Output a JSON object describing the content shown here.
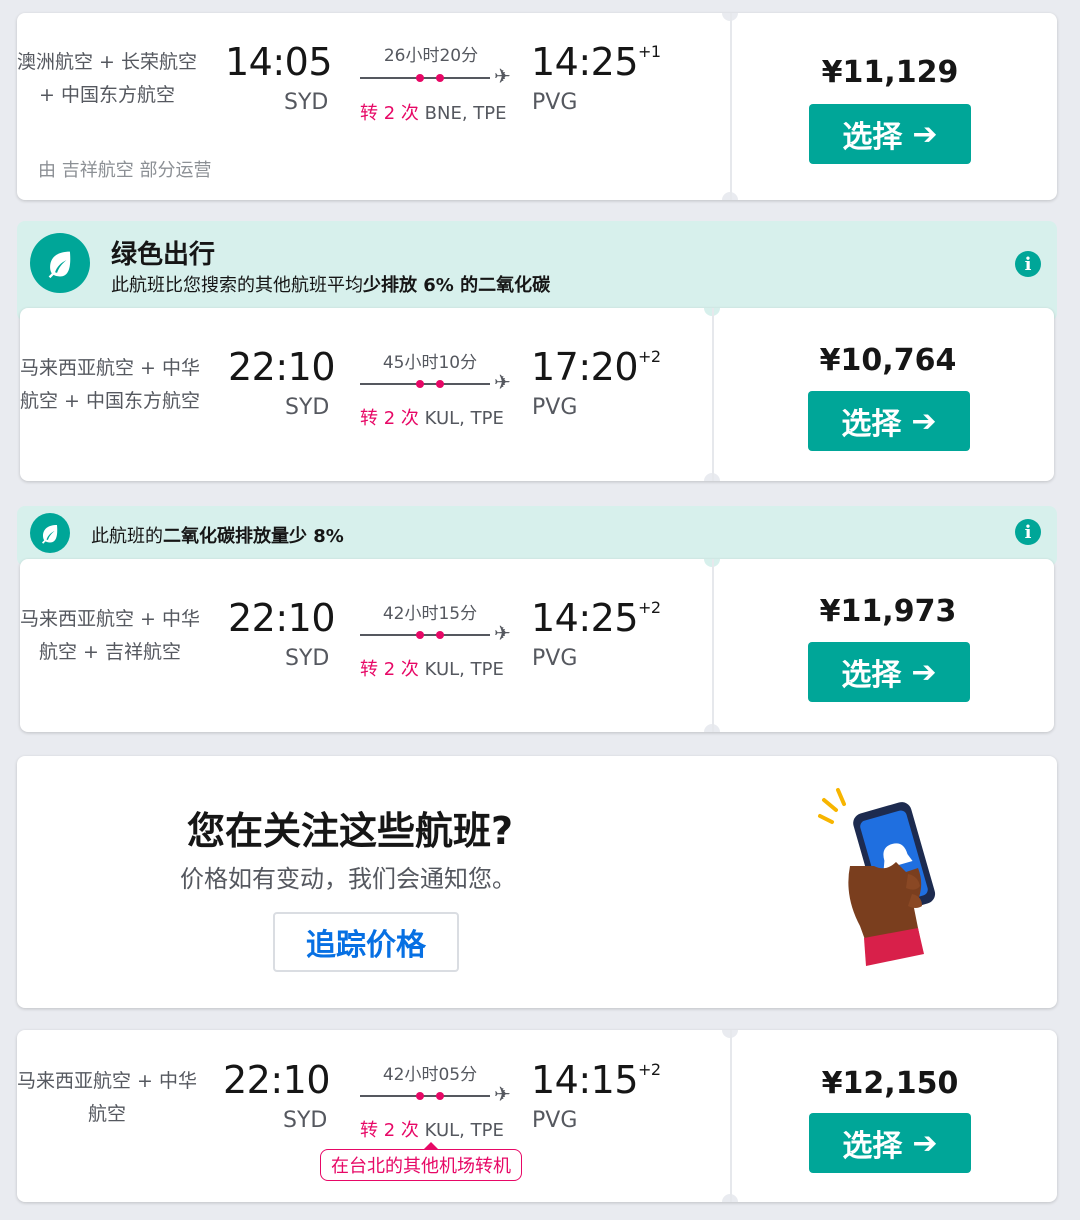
{
  "flights": [
    {
      "airline": "澳洲航空 + 长荣航空 + 中国东方航空",
      "operated_by": "由 吉祥航空 部分运营",
      "dep_time": "14:05",
      "dep_airport": "SYD",
      "duration": "26小时20分",
      "stops_count": "转 2 次",
      "stops_airports": "BNE, TPE",
      "arr_time": "14:25",
      "arr_offset": "+1",
      "arr_airport": "PVG",
      "price": "¥11,129",
      "select_label": "选择"
    },
    {
      "airline": "马来西亚航空 + 中华航空 + 中国东方航空",
      "dep_time": "22:10",
      "dep_airport": "SYD",
      "duration": "45小时10分",
      "stops_count": "转 2 次",
      "stops_airports": "KUL, TPE",
      "arr_time": "17:20",
      "arr_offset": "+2",
      "arr_airport": "PVG",
      "price": "¥10,764",
      "select_label": "选择"
    },
    {
      "airline": "马来西亚航空 + 中华航空 + 吉祥航空",
      "dep_time": "22:10",
      "dep_airport": "SYD",
      "duration": "42小时15分",
      "stops_count": "转 2 次",
      "stops_airports": "KUL, TPE",
      "arr_time": "14:25",
      "arr_offset": "+2",
      "arr_airport": "PVG",
      "price": "¥11,973",
      "select_label": "选择"
    },
    {
      "airline": "马来西亚航空 + 中华航空",
      "dep_time": "22:10",
      "dep_airport": "SYD",
      "duration": "42小时05分",
      "stops_count": "转 2 次",
      "stops_airports": "KUL, TPE",
      "arr_time": "14:15",
      "arr_offset": "+2",
      "arr_airport": "PVG",
      "price": "¥12,150",
      "select_label": "选择",
      "warning": "在台北的其他机场转机"
    }
  ],
  "eco_banner_1": {
    "title": "绿色出行",
    "text_pre": "此航班比您搜索的其他航班平均",
    "text_bold": "少排放 6% 的二氧化碳"
  },
  "eco_banner_2": {
    "text_pre": "此航班的",
    "text_bold": "二氧化碳排放量少 8%"
  },
  "price_alert": {
    "title": "您在关注这些航班?",
    "subtitle": "价格如有变动，我们会通知您。",
    "button": "追踪价格"
  },
  "icons": {
    "leaf": "leaf-icon",
    "info": "info-icon",
    "plane": "plane-icon",
    "arrow": "arrow-right-icon",
    "phone": "phone-hand-illustration"
  },
  "colors": {
    "accent": "#00a698",
    "eco_bg": "#d7f0ec",
    "stop_red": "#e70866",
    "link_blue": "#0770e3"
  }
}
